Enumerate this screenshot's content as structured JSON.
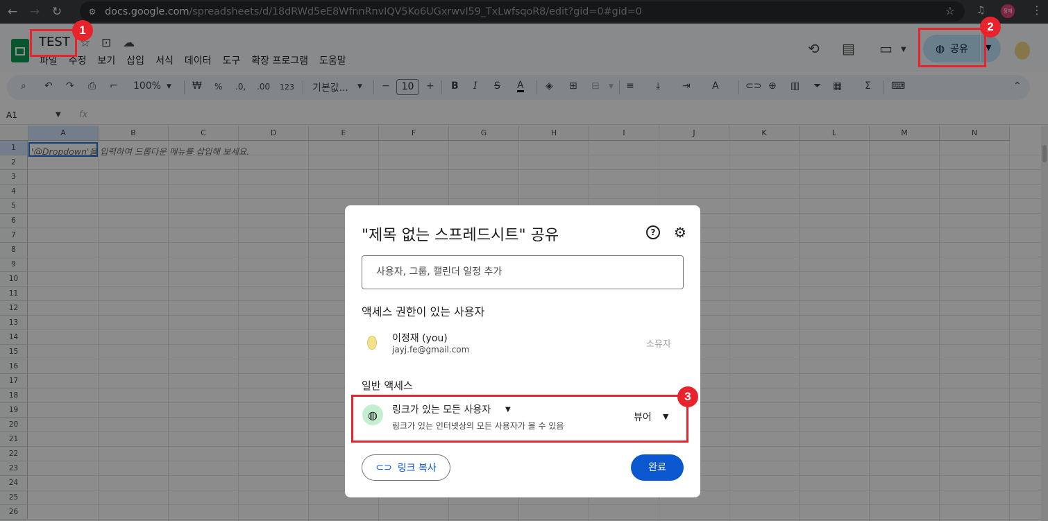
{
  "browser": {
    "url_domain": "docs.google.com",
    "url_path": "/spreadsheets/d/18dRWd5eE8WfnnRnvIQV5Ko6UGxrwvI59_TxLwfsqoR8/edit?gid=0#gid=0",
    "profile_label": "정재"
  },
  "sheet": {
    "title": "TEST",
    "menu": [
      "파일",
      "수정",
      "보기",
      "삽입",
      "서식",
      "데이터",
      "도구",
      "확장 프로그램",
      "도움말"
    ],
    "share_label": "공유"
  },
  "toolbar": {
    "zoom": "100%",
    "currency": "₩",
    "percent": "%",
    "dec_decrease": ".0,",
    "dec_increase": ".00",
    "format_123": "123",
    "font": "기본값...",
    "font_size": "10"
  },
  "formula": {
    "name_box": "A1",
    "fx": "fx"
  },
  "grid": {
    "columns": [
      "A",
      "B",
      "C",
      "D",
      "E",
      "F",
      "G",
      "H",
      "I",
      "J",
      "K",
      "L",
      "M",
      "N"
    ],
    "rows": [
      "1",
      "2",
      "3",
      "4",
      "5",
      "6",
      "7",
      "8",
      "9",
      "10",
      "11",
      "12",
      "13",
      "14",
      "15",
      "16",
      "17",
      "18",
      "19",
      "20",
      "21",
      "22",
      "23",
      "24",
      "25",
      "26"
    ],
    "cell_hint": "'@Dropdown'을 입력하여 드롭다운 메뉴를 삽입해 보세요."
  },
  "dialog": {
    "title": "\"제목 없는 스프레드시트\" 공유",
    "help": "?",
    "input_placeholder": "사용자, 그룹, 캘린더 일정 추가",
    "access_header": "액세스 권한이 있는 사용자",
    "user_name": "이정재 (you)",
    "user_email": "jayj.fe@gmail.com",
    "user_role": "소유자",
    "general_header": "일반 액세스",
    "link_access": "링크가 있는 모든 사용자",
    "link_desc": "링크가 있는 인터넷상의 모든 사용자가 볼 수 있음",
    "link_role": "뷰어",
    "copy_link": "링크 복사",
    "done": "완료"
  },
  "annotations": [
    "1",
    "2",
    "3"
  ],
  "colors": {
    "annotation_red": "#e8232b",
    "share_button": "#c2e7ff",
    "done_button": "#0b57d0",
    "sheets_green": "#0f9d58"
  }
}
